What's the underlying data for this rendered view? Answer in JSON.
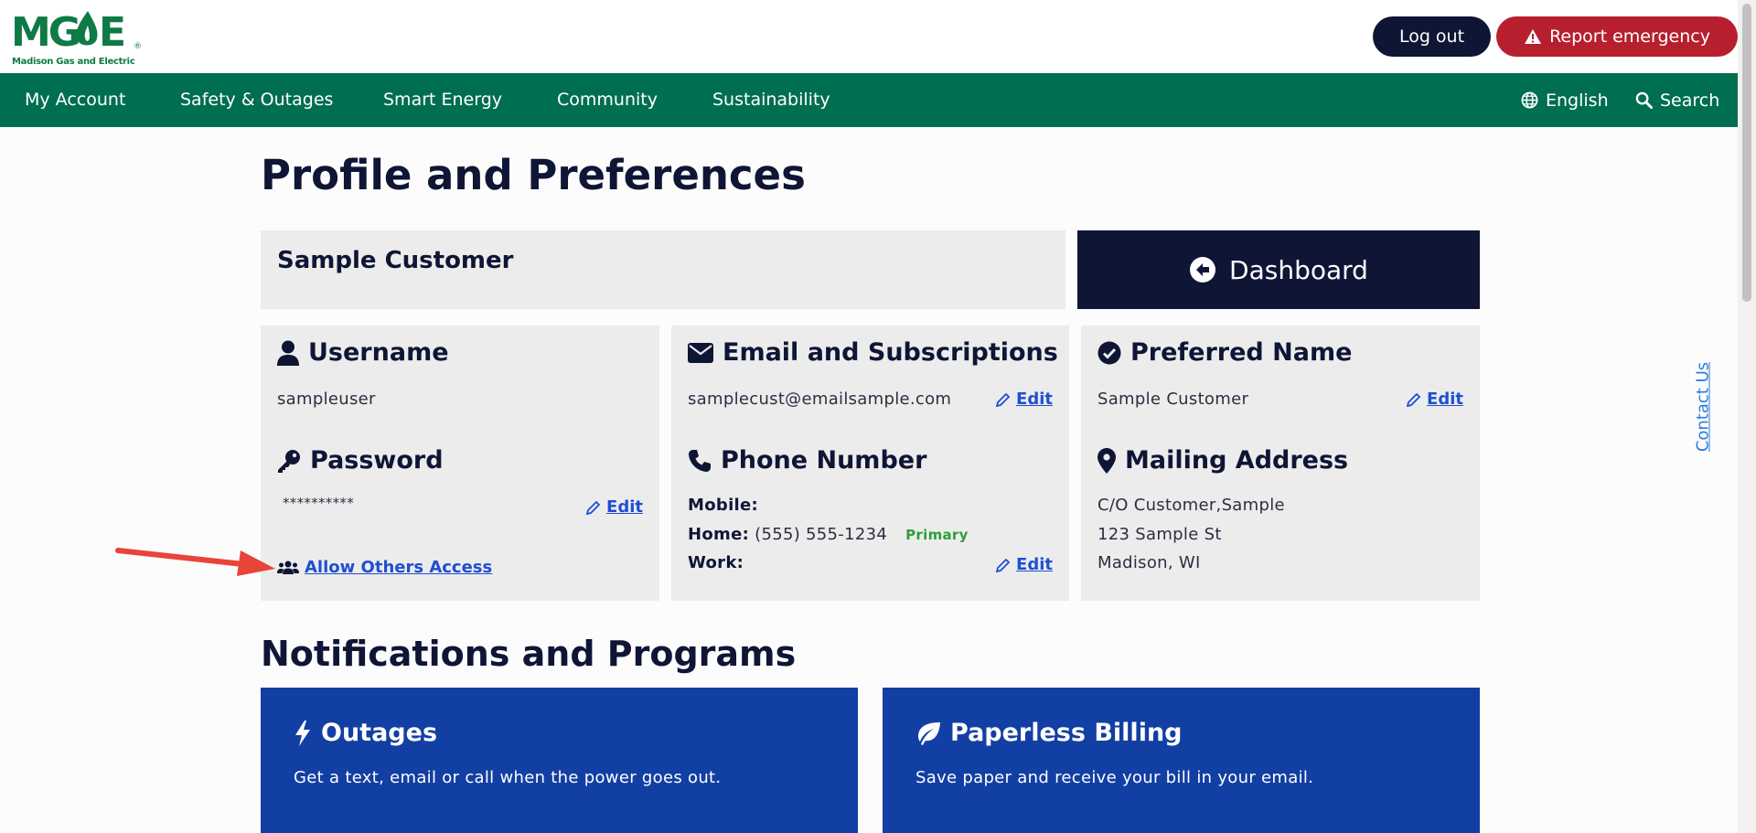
{
  "brand": {
    "logo_text": "MGOE",
    "logo_subtitle": "Madison Gas and Electric",
    "colors": {
      "green": "#006e51",
      "navy": "#0f1535",
      "red": "#b81f2e",
      "blue": "#123fa3",
      "link": "#1f4fd1"
    }
  },
  "header": {
    "logout_label": "Log out",
    "emergency_label": "Report emergency",
    "emergency_icon": "warning-icon"
  },
  "nav": {
    "items": [
      {
        "label": "My Account"
      },
      {
        "label": "Safety & Outages"
      },
      {
        "label": "Smart Energy"
      },
      {
        "label": "Community"
      },
      {
        "label": "Sustainability"
      }
    ],
    "language_label": "English",
    "search_label": "Search"
  },
  "contact_us_label": "Contact Us",
  "page": {
    "title": "Profile and Preferences",
    "customer_name": "Sample Customer",
    "dashboard_label": "Dashboard"
  },
  "cards": {
    "username": {
      "heading": "Username",
      "value": "sampleuser",
      "icon": "user-icon"
    },
    "password": {
      "heading": "Password",
      "value": "**********",
      "edit_label": "Edit",
      "icon": "key-icon"
    },
    "allow_access_label": "Allow Others Access",
    "email": {
      "heading": "Email and Subscriptions",
      "value": "samplecust@emailsample.com",
      "edit_label": "Edit",
      "icon": "envelope-icon"
    },
    "phone": {
      "heading": "Phone Number",
      "icon": "phone-icon",
      "mobile_label": "Mobile:",
      "home_label": "Home:",
      "home_value": "(555) 555-1234",
      "primary_tag": "Primary",
      "work_label": "Work:",
      "edit_label": "Edit"
    },
    "preferred_name": {
      "heading": "Preferred Name",
      "value": "Sample Customer",
      "edit_label": "Edit",
      "icon": "check-circle-icon"
    },
    "mailing_address": {
      "heading": "Mailing Address",
      "icon": "map-pin-icon",
      "line1": "C/O Customer,Sample",
      "line2": "123 Sample St",
      "line3": "Madison, WI"
    }
  },
  "notifications": {
    "title": "Notifications and Programs",
    "programs": [
      {
        "title": "Outages",
        "description": "Get a text, email or call when the power goes out.",
        "icon": "bolt-icon"
      },
      {
        "title": "Paperless Billing",
        "description": "Save paper and receive your bill in your email.",
        "icon": "leaf-icon"
      }
    ]
  }
}
